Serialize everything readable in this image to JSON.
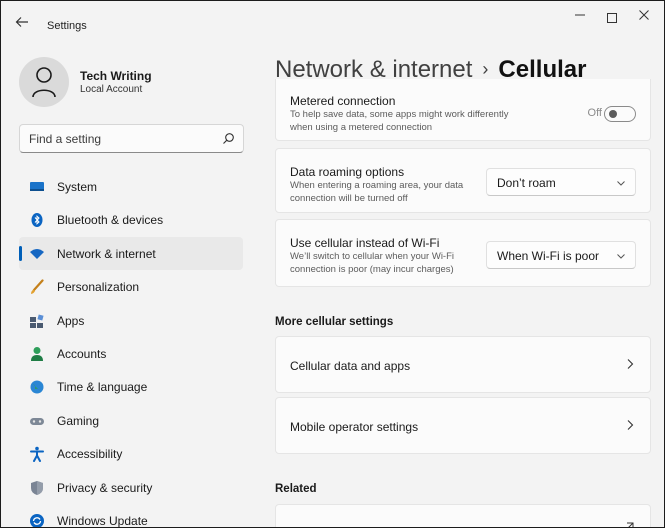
{
  "window": {
    "title": "Settings",
    "back_icon": "back-arrow-icon",
    "controls": [
      "minimize",
      "maximize",
      "close"
    ]
  },
  "profile": {
    "name": "Tech Writing",
    "account_type": "Local Account",
    "avatar_icon": "person-icon"
  },
  "search": {
    "placeholder": "Find a setting",
    "icon": "search-icon"
  },
  "nav": {
    "items": [
      {
        "label": "System",
        "icon": "system-icon"
      },
      {
        "label": "Bluetooth & devices",
        "icon": "bluetooth-icon"
      },
      {
        "label": "Network & internet",
        "icon": "wifi-icon",
        "selected": true
      },
      {
        "label": "Personalization",
        "icon": "brush-icon"
      },
      {
        "label": "Apps",
        "icon": "apps-icon"
      },
      {
        "label": "Accounts",
        "icon": "accounts-icon"
      },
      {
        "label": "Time & language",
        "icon": "globe-clock-icon"
      },
      {
        "label": "Gaming",
        "icon": "gamepad-icon"
      },
      {
        "label": "Accessibility",
        "icon": "accessibility-icon"
      },
      {
        "label": "Privacy & security",
        "icon": "shield-icon"
      },
      {
        "label": "Windows Update",
        "icon": "update-icon"
      }
    ]
  },
  "breadcrumb": {
    "parent": "Network & internet",
    "separator": "›",
    "current": "Cellular"
  },
  "metered": {
    "title": "Metered connection",
    "description": "To help save data, some apps might work differently when using a metered connection",
    "toggle_label": "Off",
    "toggle_on": false
  },
  "roaming": {
    "title": "Data roaming options",
    "description": "When entering a roaming area, your data connection will be turned off",
    "selected": "Don’t roam"
  },
  "cellular_instead": {
    "title": "Use cellular instead of Wi-Fi",
    "description": "We’ll switch to cellular when your Wi-Fi connection is poor (may incur charges)",
    "selected": "When Wi-Fi is poor"
  },
  "more_section": {
    "heading": "More cellular settings",
    "links": [
      {
        "label": "Cellular data and apps"
      },
      {
        "label": "Mobile operator settings"
      }
    ]
  },
  "related": {
    "heading": "Related"
  },
  "colors": {
    "accent": "#005fb8",
    "background": "#f3f3f3",
    "card": "#fbfbfb"
  }
}
